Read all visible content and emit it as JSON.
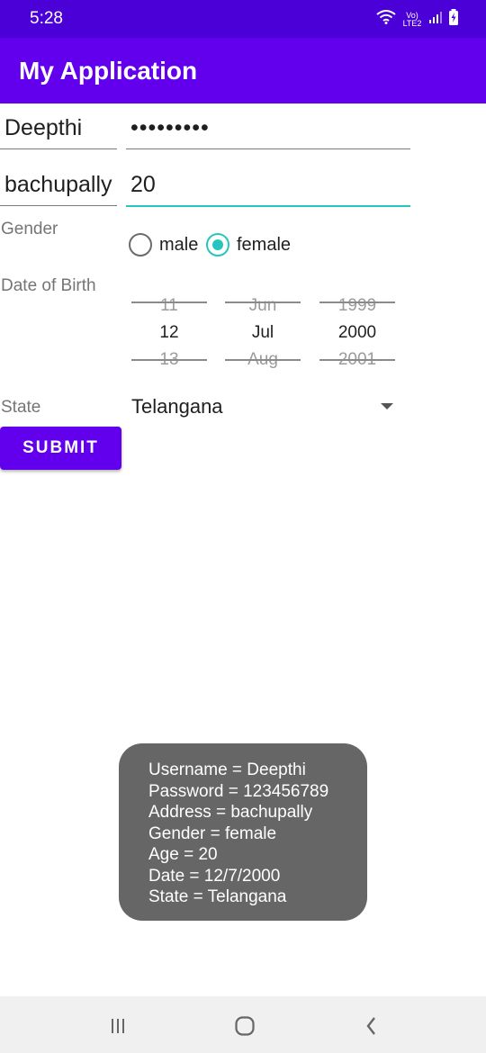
{
  "status_bar": {
    "time": "5:28",
    "network_top": "Vo)",
    "network_bottom": "LTE2",
    "icons": [
      "wifi-icon",
      "signal-icon",
      "battery-charging-icon"
    ]
  },
  "app_bar": {
    "title": "My Application"
  },
  "form": {
    "username_value": "Deepthi",
    "password_value": "•••••••••",
    "address_value": "bachupally",
    "age_value": "20",
    "gender_label": "Gender",
    "gender_options": [
      {
        "label": "male",
        "checked": false
      },
      {
        "label": "female",
        "checked": true
      }
    ],
    "dob_label": "Date of Birth",
    "date_picker": {
      "day": {
        "prev": "11",
        "selected": "12",
        "next": "13"
      },
      "month": {
        "prev": "Jun",
        "selected": "Jul",
        "next": "Aug"
      },
      "year": {
        "prev": "1999",
        "selected": "2000",
        "next": "2001"
      }
    },
    "state_label": "State",
    "state_value": "Telangana",
    "submit_label": "SUBMIT"
  },
  "toast": {
    "lines": [
      "Username = Deepthi",
      "Password = 123456789",
      "Address = bachupally",
      "Gender = female",
      "Age = 20",
      "Date = 12/7/2000",
      "State = Telangana"
    ]
  },
  "nav_bar": {
    "icons": [
      "recent-apps-icon",
      "home-icon",
      "back-icon"
    ]
  },
  "colors": {
    "status_bar": "#4a00d6",
    "primary": "#6200ee",
    "accent": "#26c6bf",
    "toast_bg": "#666666",
    "nav_bg": "#f0f0f0"
  }
}
